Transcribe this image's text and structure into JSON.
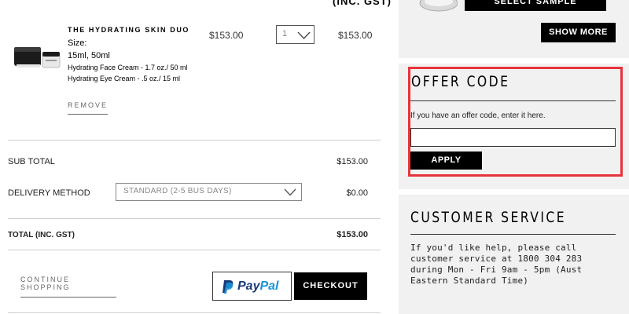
{
  "cart": {
    "header_price_suffix": "(INC. GST)",
    "item": {
      "image_icon": "skincare-jars-image",
      "name": "THE HYDRATING SKIN DUO",
      "size_label": "Size:",
      "size_value": "15ml, 50ml",
      "details": [
        "Hydrating Face Cream - 1.7 oz./ 50 ml",
        "Hydrating Eye Cream - .5 oz./ 15 ml"
      ],
      "remove_label": "REMOVE",
      "unit_price": "$153.00",
      "quantity": "1",
      "line_total": "$153.00"
    },
    "summary": {
      "subtotal_label": "SUB TOTAL",
      "subtotal_value": "$153.00",
      "delivery_label": "DELIVERY METHOD",
      "delivery_option": "STANDARD (2-5 BUS DAYS)",
      "delivery_value": "$0.00",
      "total_label": "TOTAL (INC. GST)",
      "total_value": "$153.00"
    },
    "actions": {
      "continue_label": "CONTINUE SHOPPING",
      "paypal_label_pay": "Pay",
      "paypal_label_pal": "Pal",
      "checkout_label": "CHECKOUT"
    }
  },
  "sidebar": {
    "samples": {
      "select_sample_label": "SELECT SAMPLE",
      "show_more_label": "SHOW MORE"
    },
    "offer": {
      "title": "OFFER CODE",
      "hint": "If you have an offer code, enter it here.",
      "input_value": "",
      "apply_label": "APPLY",
      "highlight_color": "#e8333b"
    },
    "customer_service": {
      "title": "CUSTOMER SERVICE",
      "lines": [
        "If you'd like help, please call",
        "customer service at 1800 304 283",
        "during Mon - Fri 9am - 5pm (Aust",
        "Eastern Standard Time)"
      ]
    }
  }
}
